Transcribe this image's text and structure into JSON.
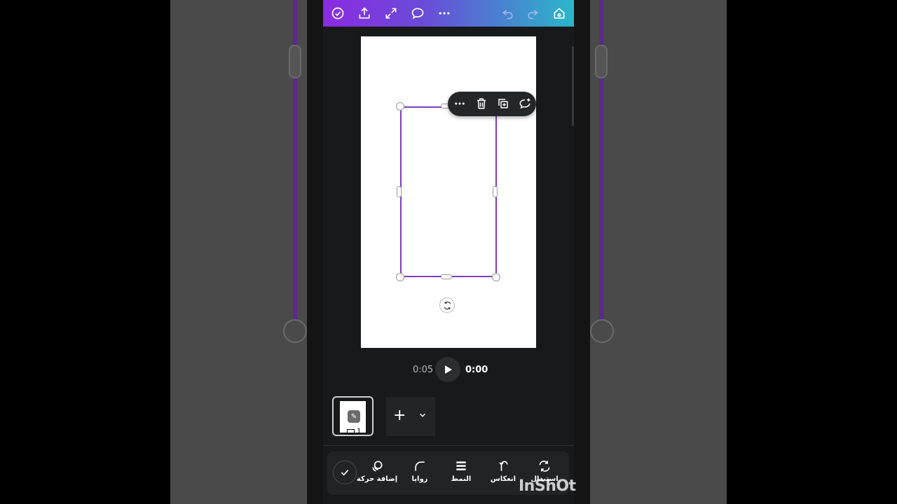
{
  "topbar": {
    "icons": [
      "check-circle-icon",
      "share-icon",
      "fullscreen-icon",
      "comment-icon",
      "more-icon",
      "undo-icon",
      "redo-icon",
      "home-icon"
    ]
  },
  "context_menu": {
    "icons": [
      "more-icon",
      "trash-icon",
      "duplicate-icon",
      "comment-add-icon"
    ]
  },
  "playback": {
    "duration": "0:05",
    "current_time": "0:00"
  },
  "pages": {
    "current_page_number": "1"
  },
  "toolbar": {
    "items": [
      {
        "label": "إضافة حركة",
        "icon": "animate-icon"
      },
      {
        "label": "زوايا",
        "icon": "corner-icon"
      },
      {
        "label": "النمط",
        "icon": "style-lines-icon"
      },
      {
        "label": "انعكاس",
        "icon": "flip-icon"
      },
      {
        "label": "استبدال",
        "icon": "replace-icon"
      }
    ]
  },
  "watermark": "InShOt",
  "colors": {
    "frame_border": "#7d3cc4",
    "topbar_gradient_start": "#8a2be2",
    "topbar_gradient_end": "#2ab7c9"
  }
}
